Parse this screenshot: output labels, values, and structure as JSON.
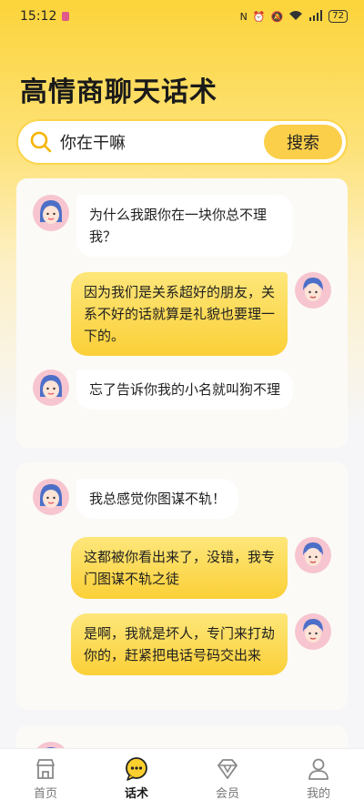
{
  "status": {
    "time": "15:12",
    "battery": "72"
  },
  "header": {
    "title": "高情商聊天话术"
  },
  "search": {
    "value": "你在干嘛",
    "button_label": "搜索"
  },
  "cards": [
    {
      "messages": [
        {
          "side": "left",
          "text": "为什么我跟你在一块你总不理我？"
        },
        {
          "side": "right",
          "text": "因为我们是关系超好的朋友，关系不好的话就算是礼貌也要理一下的。"
        },
        {
          "side": "left",
          "text": "忘了告诉你我的小名就叫狗不理"
        }
      ]
    },
    {
      "messages": [
        {
          "side": "left",
          "text": "我总感觉你图谋不轨！"
        },
        {
          "side": "right",
          "text": "这都被你看出来了，没错，我专门图谋不轨之徒"
        },
        {
          "side": "right",
          "text": "是啊，我就是坏人，专门来打劫你的，赶紧把电话号码交出来"
        }
      ]
    }
  ],
  "tabs": [
    {
      "label": "首页",
      "icon": "home-icon"
    },
    {
      "label": "话术",
      "icon": "chat-icon",
      "active": true
    },
    {
      "label": "会员",
      "icon": "diamond-icon"
    },
    {
      "label": "我的",
      "icon": "profile-icon"
    }
  ],
  "colors": {
    "accent": "#fbcf4a",
    "bubble_right": "#fbd038"
  }
}
